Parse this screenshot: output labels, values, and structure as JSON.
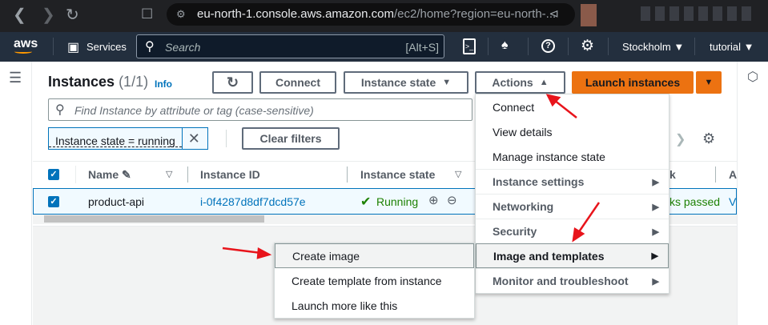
{
  "browser": {
    "url_host": "eu-north-1.console.aws.amazon.com",
    "url_path": "/ec2/home?region=eu-north-..."
  },
  "topnav": {
    "logo": "aws",
    "services": "Services",
    "search_placeholder": "Search",
    "search_shortcut": "[Alt+S]",
    "region": "Stockholm",
    "account": "tutorial"
  },
  "header": {
    "title": "Instances",
    "count": "(1/1)",
    "info": "Info"
  },
  "toolbar": {
    "connect": "Connect",
    "instance_state": "Instance state",
    "actions": "Actions",
    "launch": "Launch instances"
  },
  "filter": {
    "placeholder": "Find Instance by attribute or tag (case-sensitive)",
    "token": "Instance state = running",
    "clear": "Clear filters"
  },
  "table": {
    "columns": [
      "Name",
      "Instance ID",
      "Instance state",
      "k",
      "A"
    ],
    "rows": [
      {
        "name": "product-api",
        "id": "i-0f4287d8df7dcd57e",
        "state": "Running",
        "check": "ks passed",
        "az": "V"
      }
    ]
  },
  "actions_menu": [
    {
      "label": "Connect",
      "submenu": false
    },
    {
      "label": "View details",
      "submenu": false
    },
    {
      "label": "Manage instance state",
      "submenu": false
    },
    {
      "label": "Instance settings",
      "submenu": true
    },
    {
      "label": "Networking",
      "submenu": true
    },
    {
      "label": "Security",
      "submenu": true
    },
    {
      "label": "Image and templates",
      "submenu": true
    },
    {
      "label": "Monitor and troubleshoot",
      "submenu": true
    }
  ],
  "image_submenu": [
    "Create image",
    "Create template from instance",
    "Launch more like this"
  ],
  "colors": {
    "accent": "#ec7211",
    "link": "#0073bb",
    "success": "#1d8102",
    "annotation": "#e8141b"
  }
}
